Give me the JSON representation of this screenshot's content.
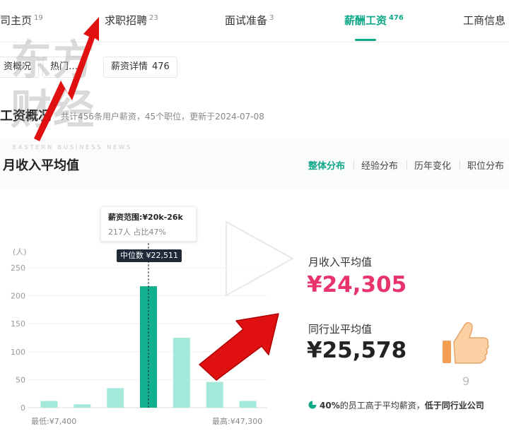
{
  "nav": {
    "tabs": [
      {
        "label": "司主页",
        "count": "19"
      },
      {
        "label": "求职招聘",
        "count": "23"
      },
      {
        "label": "面试准备",
        "count": "3"
      },
      {
        "label": "薪酬工资",
        "count": "476"
      },
      {
        "label": "工商信息",
        "count": ""
      }
    ],
    "active_tab": "薪酬工资"
  },
  "subtabs": [
    {
      "label": "资概况",
      "count": ""
    },
    {
      "label": "热门…",
      "count": ""
    },
    {
      "label": "薪资详情",
      "count": "476"
    }
  ],
  "section": {
    "title": "工资概况",
    "subtitle": "共计456条用户薪资，45个职位，更新于2024-07-08"
  },
  "watermark": {
    "line1": "东方",
    "line2": "财经",
    "en": "EASTERN BUSINESS NEWS"
  },
  "card": {
    "title": "月收入平均值",
    "dist_tabs": [
      "整体分布",
      "经验分布",
      "历年变化",
      "职位分布"
    ],
    "active_dist_tab": "整体分布"
  },
  "chart_data": {
    "type": "bar",
    "ylabel": "(人)",
    "yticks": [
      "250",
      "200",
      "150",
      "100",
      "50",
      "0"
    ],
    "ylim": [
      0,
      250
    ],
    "values": [
      12,
      6,
      35,
      217,
      125,
      46,
      12
    ],
    "highlight_index": 3,
    "x_min_label": "最低:¥7,400",
    "x_max_label": "最高:¥47,300",
    "tooltip": {
      "range": "薪资范围:¥20k-26k",
      "detail": "217人  占比47%"
    },
    "median_label": "中位数 ¥22,511",
    "colors": {
      "bar": "#a4e8d9",
      "highlight": "#12b08f",
      "median": "#1e2a38"
    }
  },
  "stats": {
    "avg_label": "月收入平均值",
    "avg_value": "¥24,305",
    "avg_color": "#e8336d",
    "industry_label": "同行业平均值",
    "industry_value": "¥25,578",
    "note_pct": "40%",
    "note_text": "的员工高于平均薪资，",
    "note_bold": "低于同行业公司"
  },
  "overlays": {
    "play_icon": "play-icon",
    "thumb_icon": "thumbs-up-icon",
    "thumb_count": "9"
  }
}
